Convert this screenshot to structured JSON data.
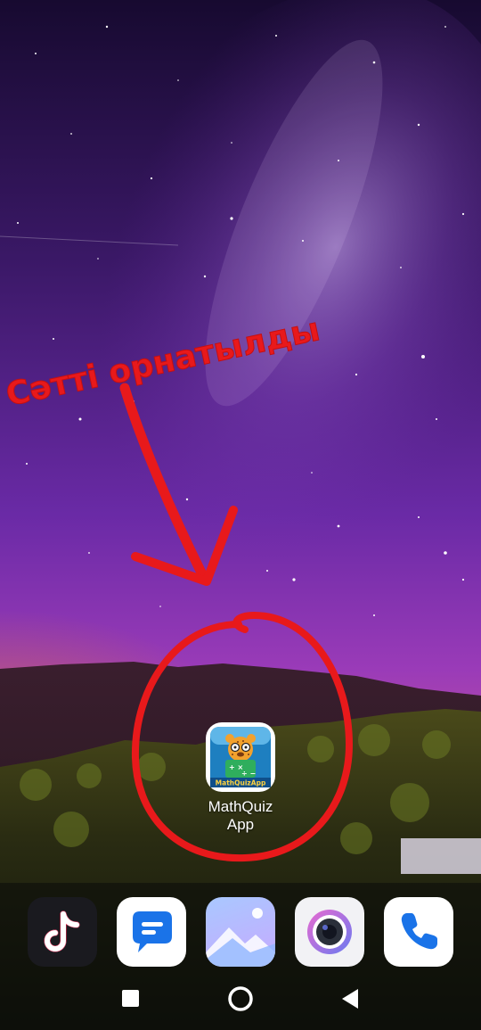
{
  "annotation": {
    "text": "Сәтті орнатылды",
    "color": "#e8191b"
  },
  "home_screen": {
    "app": {
      "label": "MathQuizApp",
      "icon": "mathquizapp-cheetah-icon",
      "icon_text": "MathQuizApp"
    }
  },
  "dock": {
    "apps": [
      {
        "icon": "tiktok-icon"
      },
      {
        "icon": "messages-icon"
      },
      {
        "icon": "gallery-icon"
      },
      {
        "icon": "camera-icon"
      },
      {
        "icon": "phone-icon"
      }
    ]
  },
  "navbar": {
    "buttons": [
      {
        "icon": "recents-square-icon"
      },
      {
        "icon": "home-circle-icon"
      },
      {
        "icon": "back-triangle-icon"
      }
    ]
  },
  "colors": {
    "sky_top": "#1c0b3a",
    "sky_mid": "#6a2aa6",
    "horizon": "#b33fb0",
    "annotation_red": "#e8191b"
  }
}
